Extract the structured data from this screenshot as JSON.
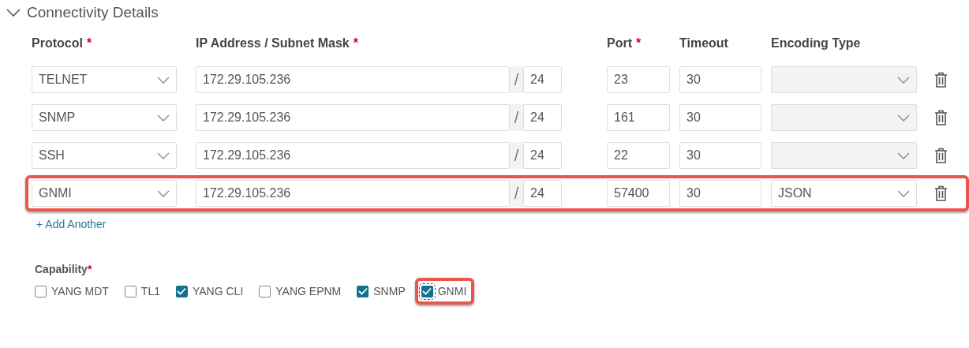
{
  "section": {
    "title": "Connectivity Details",
    "expanded": true
  },
  "columns": [
    {
      "label": "Protocol",
      "required_mark": "*"
    },
    {
      "label": "IP Address / Subnet Mask",
      "required_mark": "*"
    },
    {
      "label": "Port",
      "required_mark": "*"
    },
    {
      "label": "Timeout"
    },
    {
      "label": "Encoding Type"
    }
  ],
  "rows": [
    {
      "protocol": "TELNET",
      "ip": "172.29.105.236",
      "slash": "/",
      "mask": "24",
      "port": "23",
      "timeout": "30",
      "encoding": "",
      "encoding_disabled": true,
      "highlighted": false
    },
    {
      "protocol": "SNMP",
      "ip": "172.29.105.236",
      "slash": "/",
      "mask": "24",
      "port": "161",
      "timeout": "30",
      "encoding": "",
      "encoding_disabled": true,
      "highlighted": false
    },
    {
      "protocol": "SSH",
      "ip": "172.29.105.236",
      "slash": "/",
      "mask": "24",
      "port": "22",
      "timeout": "30",
      "encoding": "",
      "encoding_disabled": true,
      "highlighted": false
    },
    {
      "protocol": "GNMI",
      "ip": "172.29.105.236",
      "slash": "/",
      "mask": "24",
      "port": "57400",
      "timeout": "30",
      "encoding": "JSON",
      "encoding_disabled": false,
      "highlighted": true
    }
  ],
  "add_link": "+ Add Another",
  "capability": {
    "label": "Capability",
    "required_mark": "*",
    "options": [
      {
        "label": "YANG MDT",
        "checked": false,
        "highlighted": false
      },
      {
        "label": "TL1",
        "checked": false,
        "highlighted": false
      },
      {
        "label": "YANG CLI",
        "checked": true,
        "highlighted": false
      },
      {
        "label": "YANG EPNM",
        "checked": false,
        "highlighted": false
      },
      {
        "label": "SNMP",
        "checked": true,
        "highlighted": false
      },
      {
        "label": "GNMI",
        "checked": true,
        "highlighted": true
      }
    ]
  }
}
